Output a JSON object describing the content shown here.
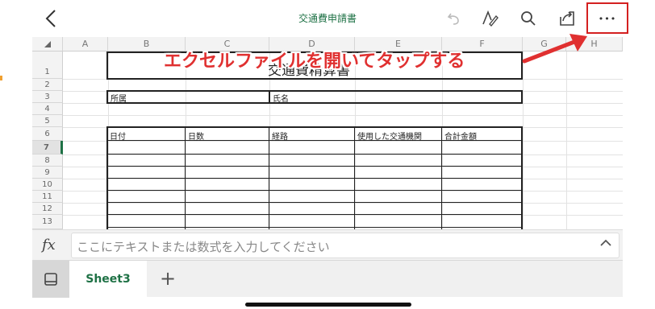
{
  "topbar": {
    "title": "交通費申請書",
    "back_icon": "chevron-left-icon",
    "undo_icon": "undo-icon",
    "pen_icon": "pen-draw-icon",
    "search_icon": "search-icon",
    "share_icon": "share-icon",
    "more_label": "•••"
  },
  "sheet": {
    "columns": [
      "A",
      "B",
      "C",
      "D",
      "E",
      "F",
      "G",
      "H"
    ],
    "rows": [
      "1",
      "2",
      "3",
      "4",
      "5",
      "6",
      "7",
      "8",
      "9",
      "10",
      "11",
      "12",
      "13"
    ],
    "form_title": "交通費精算書",
    "label_affiliation": "所属",
    "label_name": "氏名",
    "table_headers": [
      "日付",
      "日数",
      "経路",
      "使用した交通機関",
      "合計金額"
    ]
  },
  "annotation": {
    "text": "エクセルファイルを開いてタップする",
    "color": "#e03030"
  },
  "formula_bar": {
    "fx_label": "fx",
    "placeholder": "ここにテキストまたは数式を入力してください"
  },
  "tabs": {
    "active": "Sheet3",
    "add_label": "+"
  },
  "colors": {
    "accent": "#1e7145",
    "highlight": "#d42020"
  }
}
